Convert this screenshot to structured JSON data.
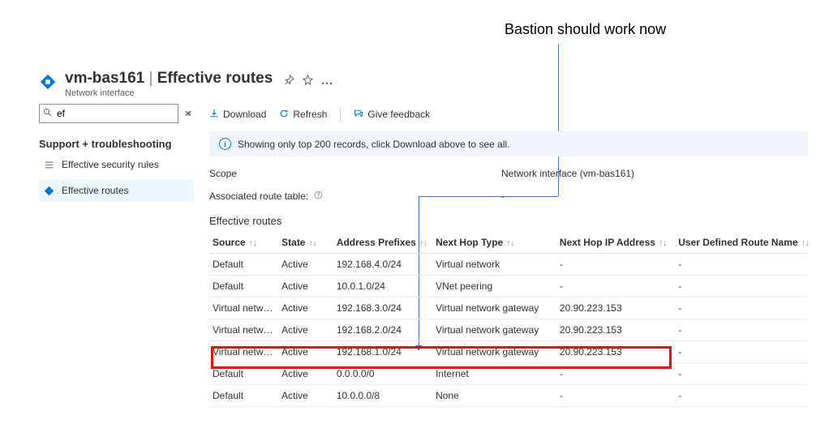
{
  "annotation": {
    "text": "Bastion should work now"
  },
  "header": {
    "resource": "vm-bas161",
    "blade": "Effective routes",
    "subtitle": "Network interface"
  },
  "sidebar": {
    "search_value": "ef",
    "section": "Support + troubleshooting",
    "items": [
      {
        "label": "Effective security rules"
      },
      {
        "label": "Effective routes"
      }
    ]
  },
  "toolbar": {
    "download": "Download",
    "refresh": "Refresh",
    "feedback": "Give feedback"
  },
  "info_bar": "Showing only top 200 records, click Download above to see all.",
  "scope": {
    "label": "Scope",
    "value": "Network interface (vm-bas161)"
  },
  "assoc": {
    "label": "Associated route table:",
    "value": "-"
  },
  "table": {
    "title": "Effective routes",
    "columns": [
      "Source",
      "State",
      "Address Prefixes",
      "Next Hop Type",
      "Next Hop IP Address",
      "User Defined Route Name"
    ],
    "rows": [
      {
        "source": "Default",
        "state": "Active",
        "prefix": "192.168.4.0/24",
        "hop": "Virtual network",
        "ip": "-",
        "udr": "-"
      },
      {
        "source": "Default",
        "state": "Active",
        "prefix": "10.0.1.0/24",
        "hop": "VNet peering",
        "ip": "-",
        "udr": "-"
      },
      {
        "source": "Virtual networ...",
        "state": "Active",
        "prefix": "192.168.3.0/24",
        "hop": "Virtual network gateway",
        "ip": "20.90.223.153",
        "udr": "-"
      },
      {
        "source": "Virtual networ...",
        "state": "Active",
        "prefix": "192.168.2.0/24",
        "hop": "Virtual network gateway",
        "ip": "20.90.223.153",
        "udr": "-"
      },
      {
        "source": "Virtual networ...",
        "state": "Active",
        "prefix": "192.168.1.0/24",
        "hop": "Virtual network gateway",
        "ip": "20.90.223.153",
        "udr": "-"
      },
      {
        "source": "Default",
        "state": "Active",
        "prefix": "0.0.0.0/0",
        "hop": "Internet",
        "ip": "-",
        "udr": "-"
      },
      {
        "source": "Default",
        "state": "Active",
        "prefix": "10.0.0.0/8",
        "hop": "None",
        "ip": "-",
        "udr": "-"
      }
    ]
  }
}
